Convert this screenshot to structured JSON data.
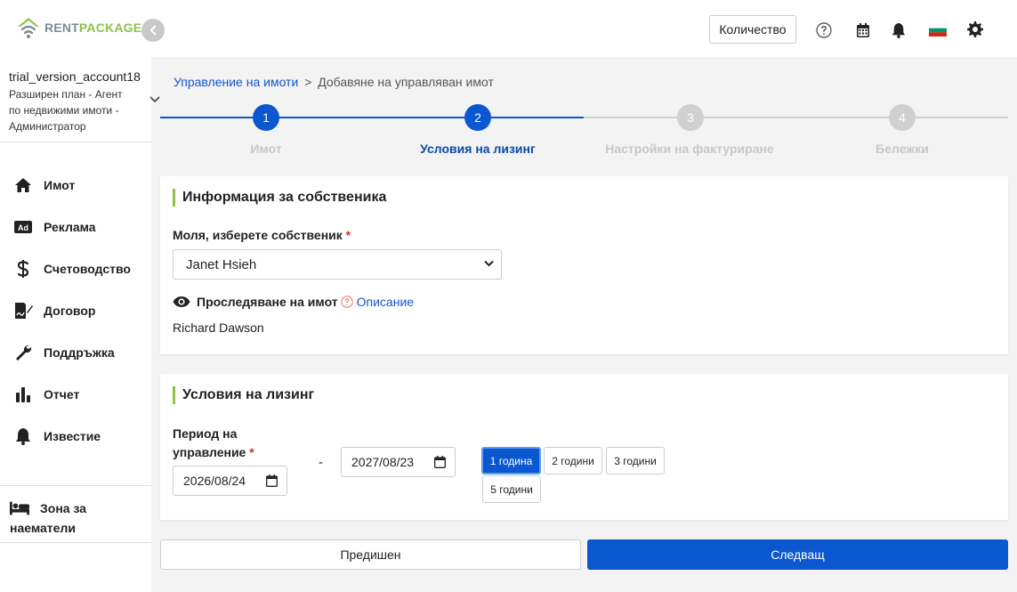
{
  "brand": {
    "rent": "RENT",
    "package": "PACKAGE"
  },
  "colors": {
    "accent": "#0b57d0",
    "brand_green": "#8bc34a",
    "inactive_step": "#d0d0d0"
  },
  "account": {
    "name": "trial_version_account18",
    "plan": "Разширен план - Агент по недвижими имоти - Администратор"
  },
  "sidebar": {
    "items": [
      {
        "label": "Имот",
        "icon": "home-icon"
      },
      {
        "label": "Реклама",
        "icon": "ad-icon"
      },
      {
        "label": "Счетоводство",
        "icon": "dollar-icon"
      },
      {
        "label": "Договор",
        "icon": "signature-icon"
      },
      {
        "label": "Поддръжка",
        "icon": "wrench-icon"
      },
      {
        "label": "Отчет",
        "icon": "bar-chart-icon"
      },
      {
        "label": "Известие",
        "icon": "bell-icon"
      }
    ],
    "tenant_zone": {
      "line1": "Зона за",
      "line2": "наематели",
      "icon": "bed-icon"
    }
  },
  "topbar": {
    "quantity_label": "Количество",
    "icons": [
      "help-icon",
      "calendar-icon",
      "bell-icon",
      "bulgaria-flag-icon",
      "gear-icon"
    ]
  },
  "breadcrumb": {
    "link": "Управление на имоти",
    "separator": ">",
    "current": "Добавяне на управляван имот"
  },
  "steps": [
    {
      "number": "1",
      "label": "Имот",
      "state": "done"
    },
    {
      "number": "2",
      "label": "Условия на лизинг",
      "state": "current"
    },
    {
      "number": "3",
      "label": "Настройки на фактуриране",
      "state": "todo"
    },
    {
      "number": "4",
      "label": "Бележки",
      "state": "todo"
    }
  ],
  "owner_section": {
    "title": "Информация за собственика",
    "owner_label": "Моля, изберете собственик",
    "required_mark": "*",
    "owner_value": "Janet Hsieh",
    "tracking_label": "Проследяване на имот",
    "description_link": "Описание",
    "tracking_value": "Richard Dawson"
  },
  "lease_section": {
    "title": "Условия на лизинг",
    "period_label_line1": "Период на",
    "period_label_line2": "управление",
    "required_mark": "*",
    "start_date": "2026/08/24",
    "dash": "-",
    "end_date": "2027/08/23",
    "period_options": [
      "1 година",
      "2 години",
      "3 години",
      "5 години"
    ],
    "selected_period": "1 година"
  },
  "buttons": {
    "previous": "Предишен",
    "next": "Следващ"
  }
}
